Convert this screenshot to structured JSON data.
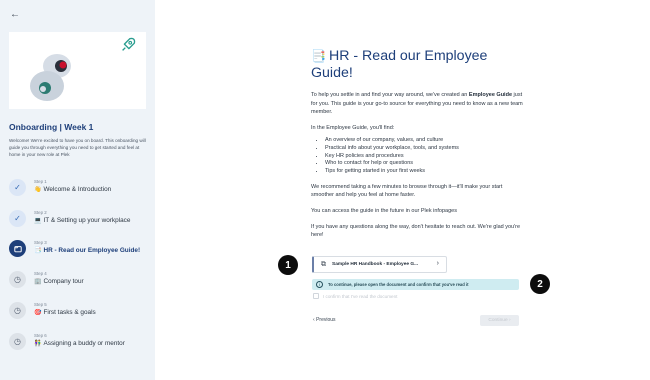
{
  "sidebar": {
    "back_icon": "←",
    "title": "Onboarding | Week 1",
    "description": "Welcome! We're excited to have you on board. This onboarding will guide you through everything you need to get started and feel at home in your new role at Plek",
    "steps": [
      {
        "step_label": "Step 1",
        "emoji": "👋",
        "name": "Welcome & Introduction",
        "status": "done",
        "icon": "check-icon"
      },
      {
        "step_label": "Step 2",
        "emoji": "💻",
        "name": "IT & Setting up your workplace",
        "status": "done",
        "icon": "check-icon"
      },
      {
        "step_label": "Step 3",
        "emoji": "📑",
        "name": "HR - Read our Employee Guide!",
        "status": "current",
        "icon": "document-icon"
      },
      {
        "step_label": "Step 4",
        "emoji": "🏢",
        "name": "Company tour",
        "status": "todo",
        "icon": "clock-icon"
      },
      {
        "step_label": "Step 5",
        "emoji": "🎯",
        "name": "First tasks & goals",
        "status": "todo",
        "icon": "clock-icon"
      },
      {
        "step_label": "Step 6",
        "emoji": "👫",
        "name": "Assigning a buddy or mentor",
        "status": "todo",
        "icon": "clock-icon"
      }
    ]
  },
  "main": {
    "title_emoji": "📑",
    "title": "HR - Read our Employee Guide!",
    "intro_before": "To help you settle in and find your way around, we've created an ",
    "intro_bold": "Employee Guide",
    "intro_after": " just for you. This guide is your go-to source for everything you need to know as a new team member.",
    "find_intro": "In the Employee Guide, you'll find:",
    "find_items": [
      "An overview of our company, values, and culture",
      "Practical info about your workplace, tools, and systems",
      "Key HR policies and procedures",
      "Who to contact for help or questions",
      "Tips for getting started in your first weeks"
    ],
    "recommend": "We recommend taking a few minutes to browse through it—it'll make your start smoother and help you feel at home faster.",
    "access": "You can access the guide in the future in our Plek infopages",
    "questions": "If you have any questions along the way, don't hesitate to reach out. We're glad you're here!",
    "handbook_label": "Sample HR Handbook - Employee G...",
    "info_message": "To continue, please open the document and confirm that you've read it",
    "confirm_label": "I confirm that I've read the document",
    "previous_label": "Previous",
    "continue_label": "Continue"
  },
  "annotations": {
    "badge1": "1",
    "badge2": "2"
  },
  "colors": {
    "accent": "#1e3f7a",
    "sidebar_bg": "#eef3f8",
    "info_bg": "#cfecf1",
    "badge": "#0c0c0c"
  }
}
